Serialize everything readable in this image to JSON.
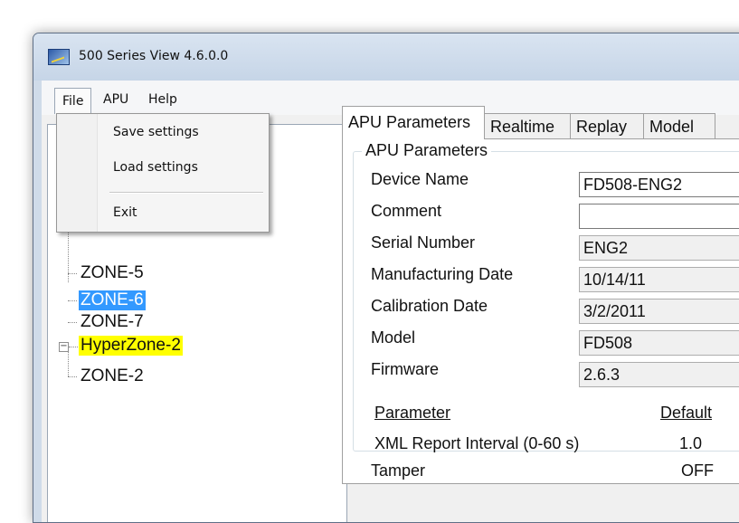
{
  "window": {
    "title": "500 Series View 4.6.0.0"
  },
  "menubar": {
    "file": "File",
    "apu": "APU",
    "help": "Help"
  },
  "file_menu": {
    "save": "Save settings",
    "load": "Load settings",
    "exit": "Exit"
  },
  "tree": {
    "zones": [
      "ZONE-5",
      "ZONE-6",
      "ZONE-7"
    ],
    "selected": "ZONE-6",
    "hyperzone": "HyperZone-2",
    "hyperzone_children": [
      "ZONE-2"
    ],
    "collapse_glyph": "−"
  },
  "tabs": [
    "APU Parameters",
    "Realtime",
    "Replay",
    "Model"
  ],
  "group": {
    "legend": "APU Parameters"
  },
  "fields": [
    {
      "label": "Device Name",
      "value": "FD508-ENG2"
    },
    {
      "label": "Comment",
      "value": ""
    },
    {
      "label": "Serial Number",
      "value": "ENG2"
    },
    {
      "label": "Manufacturing Date",
      "value": "10/14/11"
    },
    {
      "label": "Calibration Date",
      "value": "3/2/2011"
    },
    {
      "label": "Model",
      "value": "FD508"
    },
    {
      "label": "Firmware",
      "value": "2.6.3"
    }
  ],
  "params": {
    "header_param": "Parameter",
    "header_default": "Default",
    "rows": [
      {
        "name": "XML Report Interval (0-60 s)",
        "default": "1.0"
      },
      {
        "name": "Tamper",
        "default": "OFF"
      }
    ]
  },
  "icons": {
    "app": "chart-app-icon"
  }
}
